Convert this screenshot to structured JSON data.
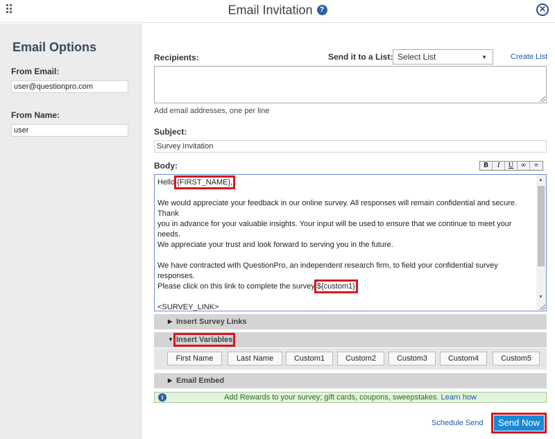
{
  "dialog": {
    "title": "Email Invitation"
  },
  "sidebar": {
    "title": "Email Options",
    "from_email_label": "From Email:",
    "from_email_value": "user@questionpro.com",
    "from_name_label": "From Name:",
    "from_name_value": "user"
  },
  "recipients": {
    "label": "Recipients:",
    "send_to_list_label": "Send it to a List:",
    "select_value": "Select List",
    "create_list": "Create List",
    "hint": "Add email addresses, one per line"
  },
  "subject": {
    "label": "Subject:",
    "value": "Survey Invitation"
  },
  "body": {
    "label": "Body:",
    "toolbar": {
      "bold": "B",
      "italic": "I",
      "underline": "U"
    },
    "greeting_prefix": "Hello ",
    "first_name_var": "{FIRST_NAME},",
    "para1_line1": "We would appreciate your feedback in our online survey.  All responses will remain confidential and secure.  Thank",
    "para1_line2": "you in advance for your valuable insights.  Your input will be used to ensure that we continue to meet your needs.",
    "para1_line3": "We appreciate your trust and look forward to serving you in the future.",
    "para2_line1": "We have contracted with QuestionPro, an independent research firm, to field your confidential survey responses.",
    "para2_line2_prefix": "Please click on this link to complete the survey ",
    "custom_var": "${custom1}",
    "survey_link": "<SURVEY_LINK>"
  },
  "sections": {
    "insert_survey_links": "Insert Survey Links",
    "insert_variables": "Insert Variables",
    "email_embed": "Email Embed"
  },
  "variables": [
    "First Name",
    "Last Name",
    "Custom1",
    "Custom2",
    "Custom3",
    "Custom4",
    "Custom5"
  ],
  "rewards": {
    "text": "Add Rewards to your survey; gift cards, coupons, sweepstakes.",
    "link": "Learn how"
  },
  "footer": {
    "schedule_send": "Schedule Send",
    "send_now": "Send Now"
  },
  "colors": {
    "accent": "#1a8ad6",
    "highlight": "#d7161f",
    "sidebar_bg": "#ececec"
  },
  "icons": [
    "drag-grip-icon",
    "help-icon",
    "close-icon",
    "info-icon"
  ]
}
